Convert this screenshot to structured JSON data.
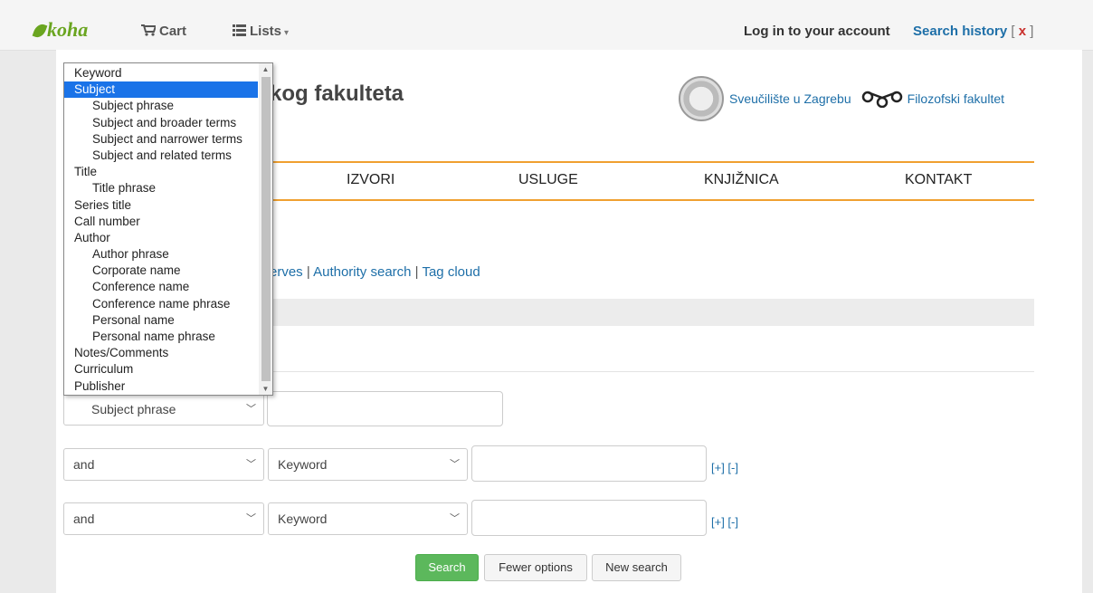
{
  "navbar": {
    "logo": "koha",
    "cart": "Cart",
    "lists": "Lists",
    "login": "Log in to your account",
    "search_history": "Search history",
    "clear": "x"
  },
  "header": {
    "title_partial": "kog fakulteta",
    "university": "Sveučilište u Zagrebu",
    "faculty": "Filozofski fakultet"
  },
  "menu": [
    "IZVORI",
    "USLUGE",
    "KNJIŽNICA",
    "KONTAKT"
  ],
  "links": {
    "reserves_partial": "erves",
    "authority": "Authority search",
    "tags": "Tag cloud"
  },
  "dropdown": {
    "selected": "Subject",
    "options": [
      {
        "label": "Keyword",
        "indent": false
      },
      {
        "label": "Subject",
        "indent": false
      },
      {
        "label": "Subject phrase",
        "indent": true
      },
      {
        "label": "Subject and broader terms",
        "indent": true
      },
      {
        "label": "Subject and narrower terms",
        "indent": true
      },
      {
        "label": "Subject and related terms",
        "indent": true
      },
      {
        "label": "Title",
        "indent": false
      },
      {
        "label": "Title phrase",
        "indent": true
      },
      {
        "label": "Series title",
        "indent": false
      },
      {
        "label": "Call number",
        "indent": false
      },
      {
        "label": "Author",
        "indent": false
      },
      {
        "label": "Author phrase",
        "indent": true
      },
      {
        "label": "Corporate name",
        "indent": true
      },
      {
        "label": "Conference name",
        "indent": true
      },
      {
        "label": "Conference name phrase",
        "indent": true
      },
      {
        "label": "Personal name",
        "indent": true
      },
      {
        "label": "Personal name phrase",
        "indent": true
      },
      {
        "label": "Notes/Comments",
        "indent": false
      },
      {
        "label": "Curriculum",
        "indent": false
      },
      {
        "label": "Publisher",
        "indent": false
      }
    ]
  },
  "search_rows": {
    "row1_index": "Subject phrase",
    "row2_op": "and",
    "row2_index": "Keyword",
    "row3_op": "and",
    "row3_index": "Keyword",
    "add_remove": "[+] [-]"
  },
  "buttons": {
    "search": "Search",
    "fewer": "Fewer options",
    "new": "New search"
  }
}
